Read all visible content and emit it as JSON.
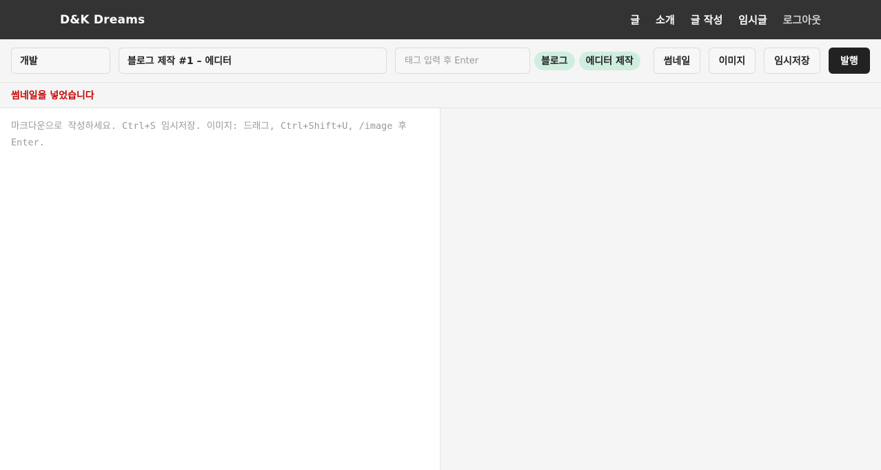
{
  "header": {
    "brand": "D&K Dreams",
    "nav": [
      "글",
      "소개",
      "글 작성",
      "임시글",
      "로그아웃"
    ]
  },
  "toolbar": {
    "category": "개발",
    "title": "블로그 제작 #1 – 에디터",
    "tag_placeholder": "태그 입력 후 Enter",
    "tags": [
      "블로그",
      "에디터 제작"
    ],
    "thumbnail_label": "썸네일",
    "image_label": "이미지",
    "draft_label": "임시저장",
    "publish_label": "발행"
  },
  "notice": "썸네일을 넣었습니다",
  "editor": {
    "placeholder": "마크다운으로 작성하세요. Ctrl+S 임시저장. 이미지: 드래그, Ctrl+Shift+U, /image 후 Enter.",
    "value": ""
  },
  "colors": {
    "header_bg": "#333333",
    "chip_bg": "#cfeee0",
    "notice_text": "#cc0000",
    "publish_bg": "#222222"
  }
}
